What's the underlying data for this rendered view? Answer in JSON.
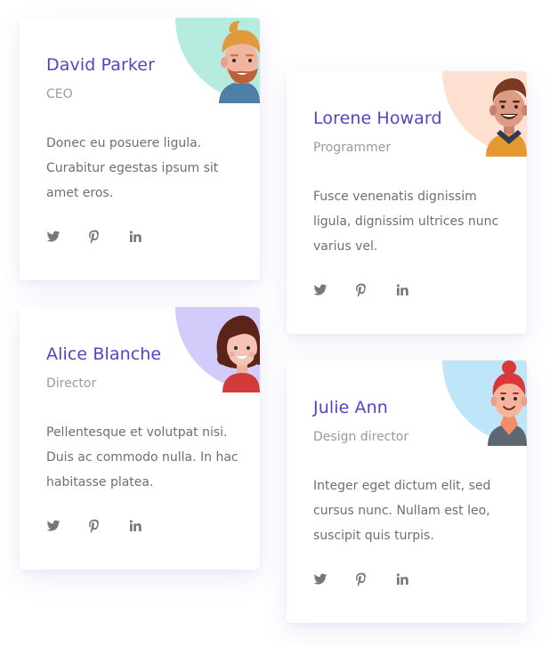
{
  "team": [
    {
      "name": "David Parker",
      "role": "CEO",
      "bio": "Donec eu posuere ligula. Curabitur egestas ipsum sit amet eros.",
      "avatar_bg": "#b6ebe0",
      "socials": [
        "twitter-icon",
        "pinterest-icon",
        "linkedin-icon"
      ]
    },
    {
      "name": "Lorene Howard",
      "role": "Programmer",
      "bio": "Fusce venenatis dignissim ligula, dignissim ultrices nunc varius vel.",
      "avatar_bg": "#fde0cf",
      "socials": [
        "twitter-icon",
        "pinterest-icon",
        "linkedin-icon"
      ]
    },
    {
      "name": "Alice Blanche",
      "role": "Director",
      "bio": "Pellentesque et volutpat nisi. Duis ac commodo nulla. In hac habitasse platea.",
      "avatar_bg": "#d3cbfa",
      "socials": [
        "twitter-icon",
        "pinterest-icon",
        "linkedin-icon"
      ]
    },
    {
      "name": "Julie Ann",
      "role": "Design director",
      "bio": "Integer eget dictum elit, sed cursus nunc. Nullam est leo, suscipit quis turpis.",
      "avatar_bg": "#bfe6f8",
      "socials": [
        "twitter-icon",
        "pinterest-icon",
        "linkedin-icon"
      ]
    }
  ],
  "colors": {
    "name": "#5b3fc9",
    "role": "#9a9a9a",
    "text": "#6f6f6f",
    "icon": "#777777"
  }
}
